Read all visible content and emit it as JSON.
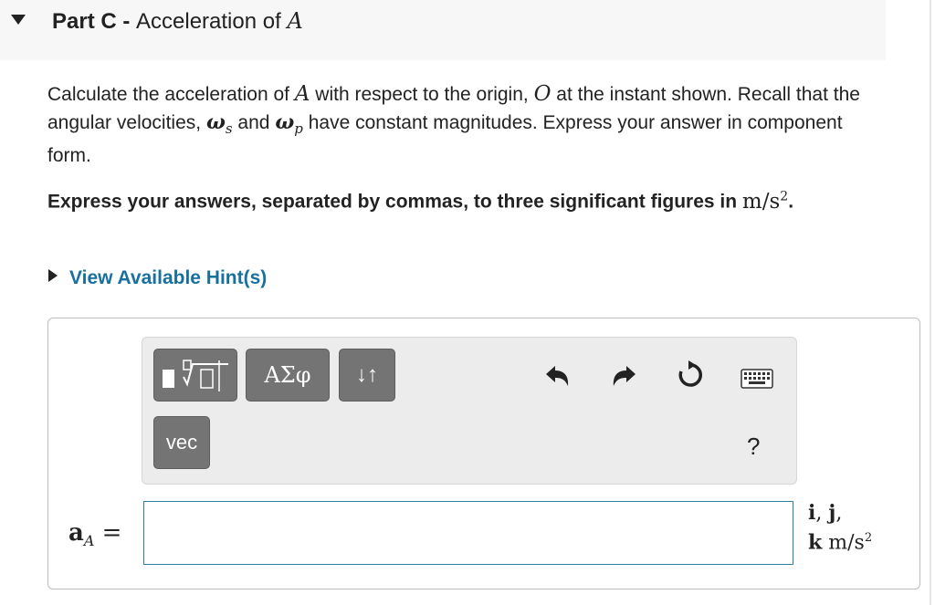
{
  "part": {
    "label": "Part C",
    "separator": " - ",
    "title": "Acceleration of ",
    "title_var": "A"
  },
  "problem": {
    "t1": "Calculate the acceleration of ",
    "var_a": "A",
    "t2": " with respect to the origin, ",
    "var_o": "O",
    "t3": " at the instant shown. Recall that the angular velocities, ",
    "omega1": "ω",
    "omega1_sub": "s",
    "t4": " and ",
    "omega2": "ω",
    "omega2_sub": "p",
    "t5": " have constant magnitudes. Express your answer in component form."
  },
  "instruction": {
    "text": "Express your answers, separated by commas, to three significant figures in ",
    "unit": "m/s",
    "unit_exp": "2",
    "end": "."
  },
  "hint": {
    "label": "View Available Hint(s)"
  },
  "toolbar": {
    "greek_label": "ΑΣφ",
    "arrows_label": "↓↑",
    "vec_label": "vec",
    "help_label": "?"
  },
  "answer": {
    "var": "a",
    "var_sub": "A",
    "equals": " =",
    "value": "",
    "placeholder": ""
  },
  "units": {
    "i": "i",
    "c1": ", ",
    "j": "j",
    "c2": ",",
    "k": "k",
    "unit": " m/s",
    "unit_exp": "2"
  },
  "icons": {
    "collapse": "triangle-down-icon",
    "hint_caret": "triangle-right-icon",
    "undo": "undo-icon",
    "redo": "redo-icon",
    "reset": "reset-icon",
    "keyboard": "keyboard-icon"
  },
  "colors": {
    "link": "#18709e",
    "button": "#747474",
    "input_border": "#2b7fa3"
  }
}
